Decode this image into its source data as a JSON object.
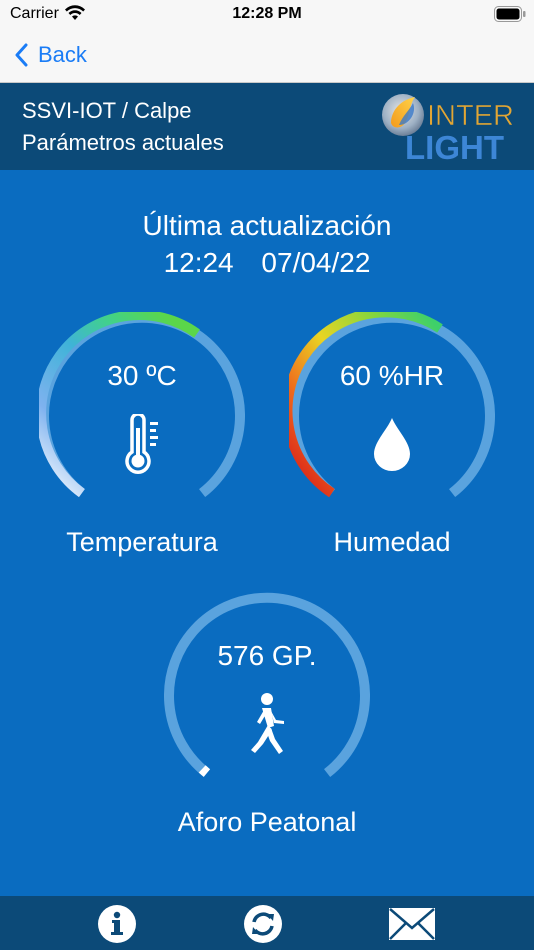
{
  "status": {
    "carrier": "Carrier",
    "time": "12:28 PM"
  },
  "nav": {
    "back_label": "Back"
  },
  "header": {
    "line1": "SSVI-IOT / Calpe",
    "line2": "Parámetros actuales",
    "logo_text_top": "INTER",
    "logo_text_bottom": "LIGHT"
  },
  "update": {
    "title": "Última actualización",
    "time": "12:24",
    "date": "07/04/22"
  },
  "gauges": {
    "temperature": {
      "value": "30 ºC",
      "label": "Temperatura",
      "icon": "thermometer-icon"
    },
    "humidity": {
      "value": "60 %HR",
      "label": "Humedad",
      "icon": "water-drop-icon"
    },
    "footfall": {
      "value": "576 GP.",
      "label": "Aforo Peatonal",
      "icon": "walking-person-icon"
    }
  },
  "tabs": [
    {
      "name": "info",
      "icon": "info-icon"
    },
    {
      "name": "refresh",
      "icon": "refresh-icon"
    },
    {
      "name": "mail",
      "icon": "mail-icon"
    }
  ],
  "colors": {
    "background": "#0a6cc0",
    "header": "#0c4a78",
    "track": "#5aa3de",
    "ios_blue": "#1a7cf6"
  }
}
